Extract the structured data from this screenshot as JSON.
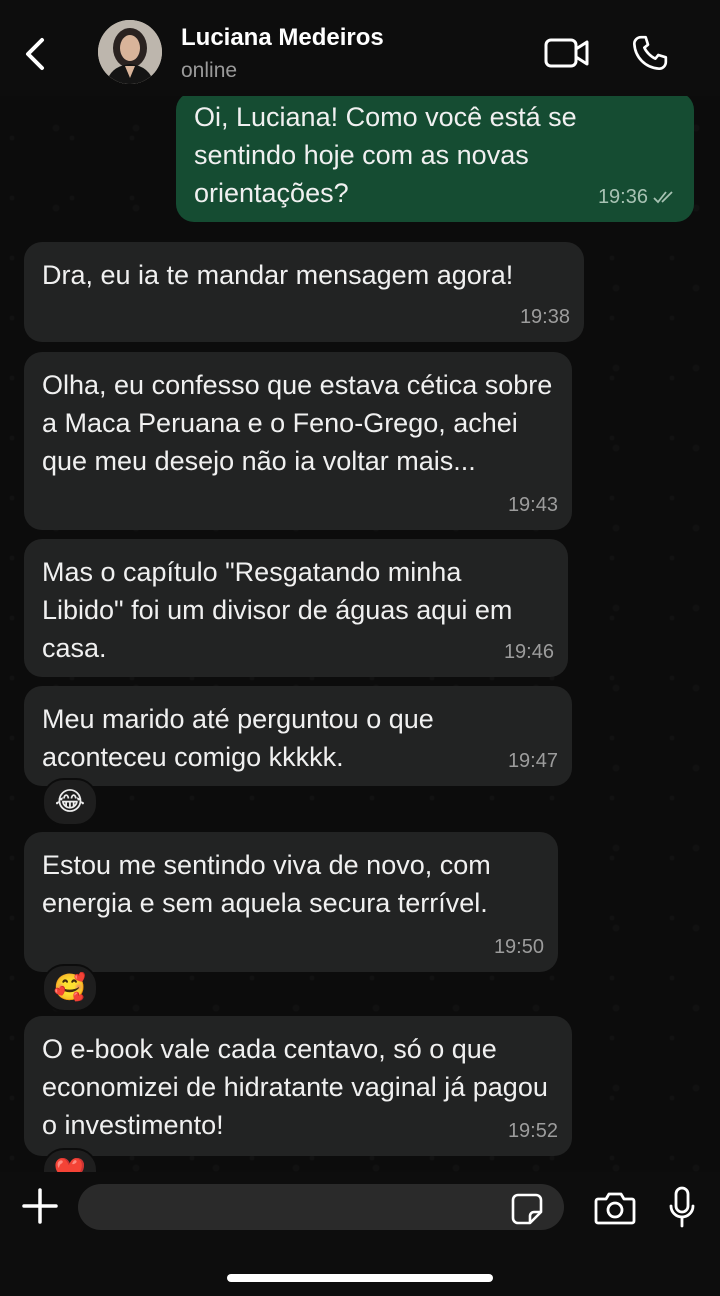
{
  "header": {
    "contact_name": "Luciana Medeiros",
    "status": "online",
    "icons": {
      "back": "chevron-left-icon",
      "video": "video-call-icon",
      "call": "phone-icon"
    }
  },
  "messages": [
    {
      "direction": "outgoing",
      "text": "Oi, Luciana! Como você está se sentindo hoje com as novas orientações?",
      "time": "19:36",
      "read_receipt": "double-check-icon"
    },
    {
      "direction": "incoming",
      "text": "Dra, eu ia te mandar mensagem agora!",
      "time": "19:38"
    },
    {
      "direction": "incoming",
      "text": "Olha, eu confesso que estava cética sobre a Maca Peruana e o Feno-Grego, achei que meu desejo não ia voltar mais...",
      "time": "19:43"
    },
    {
      "direction": "incoming",
      "text": "Mas o capítulo \"Resgatando minha Libido\" foi um divisor de águas aqui em casa.",
      "time": "19:46"
    },
    {
      "direction": "incoming",
      "text": "Meu marido até perguntou o que aconteceu comigo kkkkk.",
      "time": "19:47",
      "reaction": "😂"
    },
    {
      "direction": "incoming",
      "text": "Estou me sentindo viva de novo, com energia e sem aquela secura terrível.",
      "time": "19:50",
      "reaction": "🥰"
    },
    {
      "direction": "incoming",
      "text": "O e-book vale cada centavo, só o que economizei de hidratante vaginal já pagou o investimento!",
      "time": "19:52",
      "reaction": "❤️"
    }
  ],
  "composer": {
    "input_value": "",
    "icons": {
      "add": "plus-icon",
      "sticker": "sticker-icon",
      "camera": "camera-icon",
      "mic": "microphone-icon"
    }
  },
  "colors": {
    "background": "#0c0c0c",
    "incoming_bubble": "#222323",
    "outgoing_bubble": "#154c32",
    "header_bar": "#0d0d0d"
  }
}
